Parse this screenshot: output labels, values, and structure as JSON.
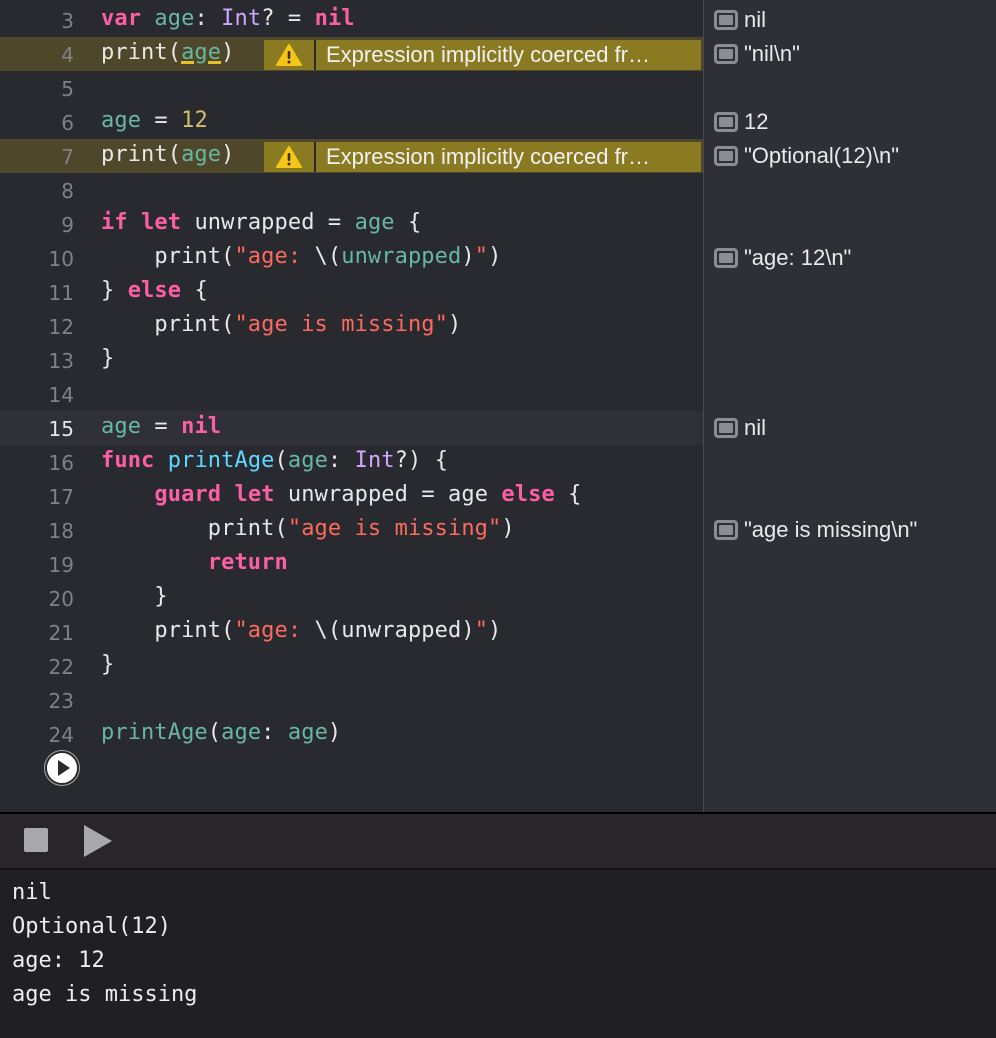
{
  "editor": {
    "lines": [
      {
        "num": "3",
        "tokens": [
          [
            "var",
            "kw"
          ],
          [
            " ",
            "plain"
          ],
          [
            "age",
            "id"
          ],
          [
            ": ",
            "plain"
          ],
          [
            "Int",
            "type"
          ],
          [
            "? = ",
            "plain"
          ],
          [
            "nil",
            "kw"
          ]
        ]
      },
      {
        "num": "4",
        "tokens": [
          [
            "print(",
            "plain"
          ],
          [
            "age",
            "id-u"
          ],
          [
            ")",
            "plain"
          ]
        ],
        "warning": "Expression implicitly coerced fr…"
      },
      {
        "num": "5",
        "tokens": []
      },
      {
        "num": "6",
        "tokens": [
          [
            "age",
            "id"
          ],
          [
            " = ",
            "plain"
          ],
          [
            "12",
            "num"
          ]
        ]
      },
      {
        "num": "7",
        "tokens": [
          [
            "print(",
            "plain"
          ],
          [
            "age",
            "id"
          ],
          [
            ")",
            "plain"
          ]
        ],
        "warning": "Expression implicitly coerced fr…"
      },
      {
        "num": "8",
        "tokens": []
      },
      {
        "num": "9",
        "tokens": [
          [
            "if",
            "kw"
          ],
          [
            " ",
            "plain"
          ],
          [
            "let",
            "kw"
          ],
          [
            " unwrapped = ",
            "plain"
          ],
          [
            "age",
            "id"
          ],
          [
            " {",
            "plain"
          ]
        ]
      },
      {
        "num": "10",
        "tokens": [
          [
            "    print(",
            "plain"
          ],
          [
            "\"age: ",
            "str"
          ],
          [
            "\\(",
            "plain"
          ],
          [
            "unwrapped",
            "id"
          ],
          [
            ")",
            "plain"
          ],
          [
            "\"",
            "str"
          ],
          [
            ")",
            "plain"
          ]
        ]
      },
      {
        "num": "11",
        "tokens": [
          [
            "} ",
            "plain"
          ],
          [
            "else",
            "kw"
          ],
          [
            " {",
            "plain"
          ]
        ]
      },
      {
        "num": "12",
        "tokens": [
          [
            "    print(",
            "plain"
          ],
          [
            "\"age is missing\"",
            "str"
          ],
          [
            ")",
            "plain"
          ]
        ]
      },
      {
        "num": "13",
        "tokens": [
          [
            "}",
            "plain"
          ]
        ]
      },
      {
        "num": "14",
        "tokens": []
      },
      {
        "num": "15",
        "tokens": [
          [
            "age",
            "id"
          ],
          [
            " = ",
            "plain"
          ],
          [
            "nil",
            "kw"
          ]
        ],
        "current": true
      },
      {
        "num": "16",
        "tokens": [
          [
            "func",
            "kw"
          ],
          [
            " ",
            "plain"
          ],
          [
            "printAge",
            "fn"
          ],
          [
            "(",
            "plain"
          ],
          [
            "age",
            "id"
          ],
          [
            ": ",
            "plain"
          ],
          [
            "Int",
            "type"
          ],
          [
            "?) {",
            "plain"
          ]
        ]
      },
      {
        "num": "17",
        "tokens": [
          [
            "    ",
            "plain"
          ],
          [
            "guard",
            "kw"
          ],
          [
            " ",
            "plain"
          ],
          [
            "let",
            "kw"
          ],
          [
            " unwrapped = age ",
            "plain"
          ],
          [
            "else",
            "kw"
          ],
          [
            " {",
            "plain"
          ]
        ]
      },
      {
        "num": "18",
        "tokens": [
          [
            "        print(",
            "plain"
          ],
          [
            "\"age is missing\"",
            "str"
          ],
          [
            ")",
            "plain"
          ]
        ]
      },
      {
        "num": "19",
        "tokens": [
          [
            "        ",
            "plain"
          ],
          [
            "return",
            "kw"
          ]
        ]
      },
      {
        "num": "20",
        "tokens": [
          [
            "    }",
            "plain"
          ]
        ]
      },
      {
        "num": "21",
        "tokens": [
          [
            "    print(",
            "plain"
          ],
          [
            "\"age: ",
            "str"
          ],
          [
            "\\(unwrapped)",
            "plain"
          ],
          [
            "\"",
            "str"
          ],
          [
            ")",
            "plain"
          ]
        ]
      },
      {
        "num": "22",
        "tokens": [
          [
            "}",
            "plain"
          ]
        ]
      },
      {
        "num": "23",
        "tokens": []
      },
      {
        "num": "24",
        "tokens": [
          [
            "printAge",
            "id"
          ],
          [
            "(",
            "plain"
          ],
          [
            "age",
            "id"
          ],
          [
            ": ",
            "plain"
          ],
          [
            "age",
            "id"
          ],
          [
            ")",
            "plain"
          ]
        ]
      }
    ]
  },
  "results": [
    {
      "line": "3",
      "text": "nil"
    },
    {
      "line": "4",
      "text": "\"nil\\n\""
    },
    {
      "line": "6",
      "text": "12"
    },
    {
      "line": "7",
      "text": "\"Optional(12)\\n\""
    },
    {
      "line": "10",
      "text": "\"age: 12\\n\""
    },
    {
      "line": "15",
      "text": "nil"
    },
    {
      "line": "18",
      "text": "\"age is missing\\n\""
    }
  ],
  "console": {
    "lines": [
      "nil",
      "Optional(12)",
      "age: 12",
      "age is missing"
    ]
  },
  "icons": {
    "warning": "warning-triangle-icon",
    "run": "run-gutter-icon",
    "stop": "stop-icon",
    "play": "play-icon",
    "quicklook": "quick-look-icon"
  },
  "colors": {
    "keyword": "#fc5fa3",
    "type": "#d0a8ff",
    "identifier": "#67b7a4",
    "number": "#d0bf69",
    "string": "#fc6a5d",
    "function": "#5dd8ff",
    "warning_bg": "#8a7a22"
  }
}
